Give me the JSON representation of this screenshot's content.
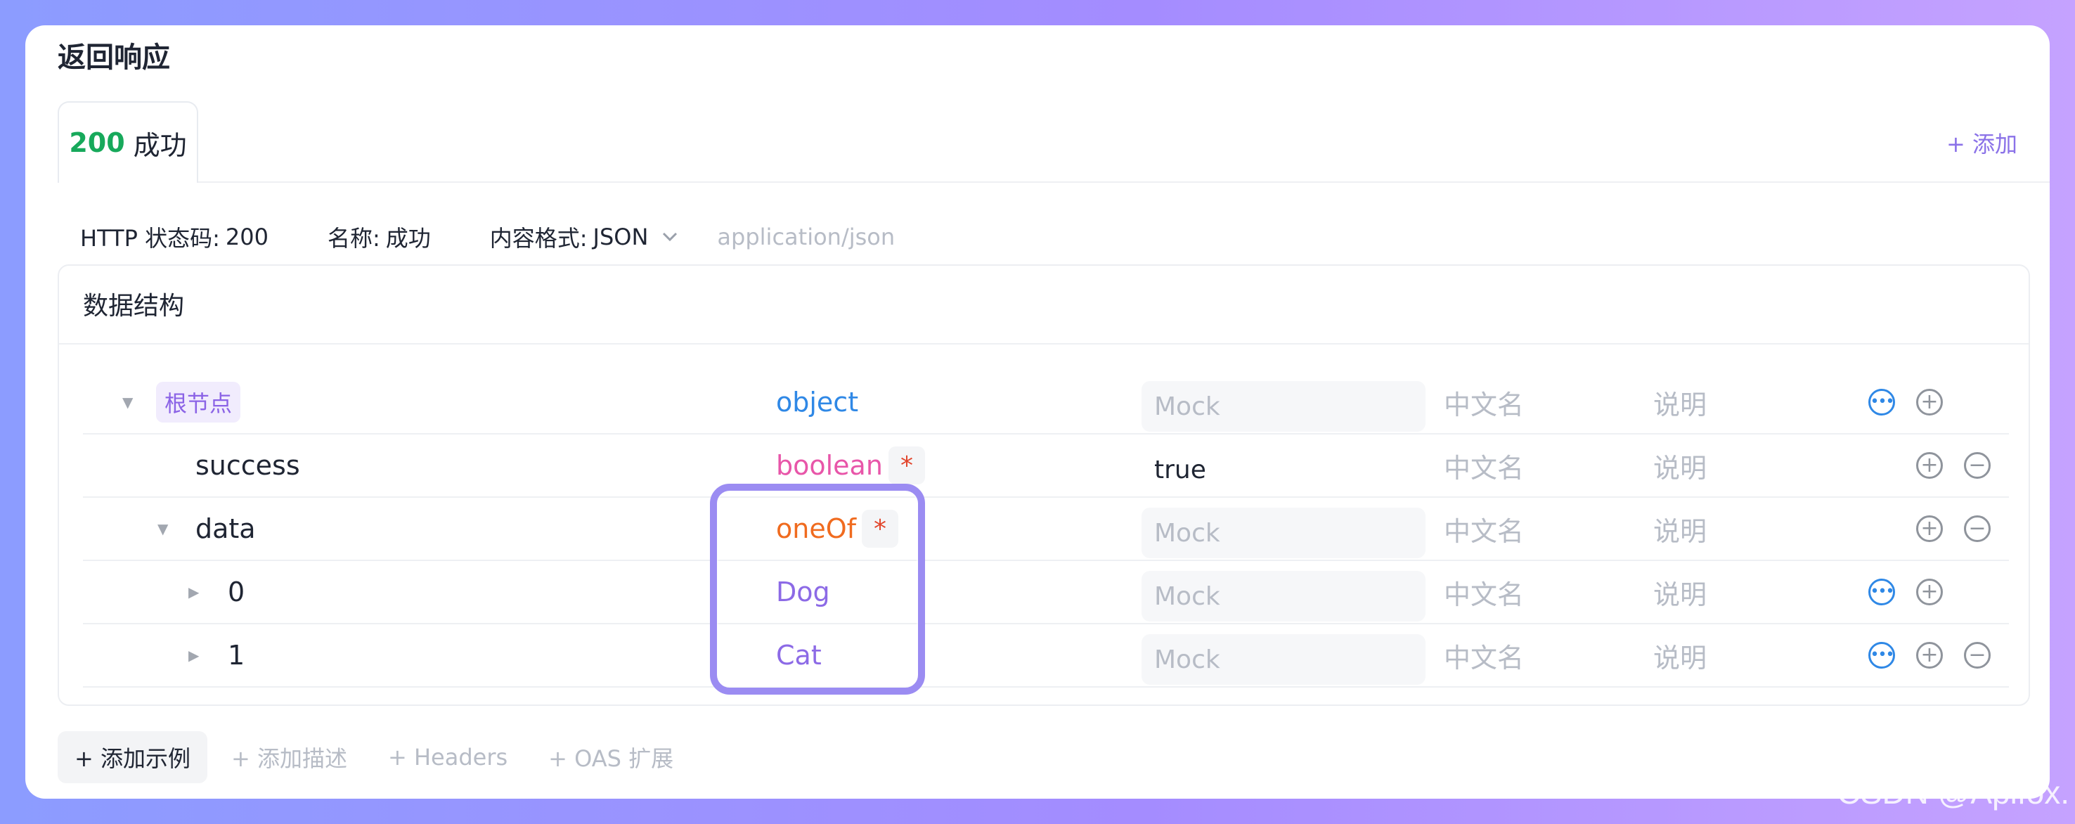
{
  "section_title": "返回响应",
  "response_tab": {
    "code": "200",
    "label": "成功"
  },
  "add_response": "+ 添加",
  "meta": {
    "status_label": "HTTP 状态码:",
    "status_value": "200",
    "name_label": "名称:",
    "name_value": "成功",
    "format_label": "内容格式:",
    "format_value": "JSON",
    "content_type_placeholder": "application/json"
  },
  "schema": {
    "title": "数据结构",
    "rows": [
      {
        "name": "根节点",
        "type": "object",
        "mock": "Mock",
        "cn": "中文名",
        "desc": "说明"
      },
      {
        "name": "success",
        "type": "boolean",
        "required": "*",
        "mock": "true",
        "cn": "中文名",
        "desc": "说明"
      },
      {
        "name": "data",
        "type": "oneOf",
        "required": "*",
        "mock": "Mock",
        "cn": "中文名",
        "desc": "说明"
      },
      {
        "name": "0",
        "type": "Dog",
        "mock": "Mock",
        "cn": "中文名",
        "desc": "说明"
      },
      {
        "name": "1",
        "type": "Cat",
        "mock": "Mock",
        "cn": "中文名",
        "desc": "说明"
      }
    ]
  },
  "bottom_actions": {
    "add_example": "+ 添加示例",
    "add_description": "+ 添加描述",
    "headers": "+ Headers",
    "oas_extension": "+ OAS 扩展"
  },
  "watermark": "CSDN @Apifox.",
  "colors": {
    "accent": "#8b72e8",
    "status_success": "#17a95b",
    "object": "#2f88e6",
    "boolean": "#e856a9",
    "oneof": "#f06b1f"
  }
}
